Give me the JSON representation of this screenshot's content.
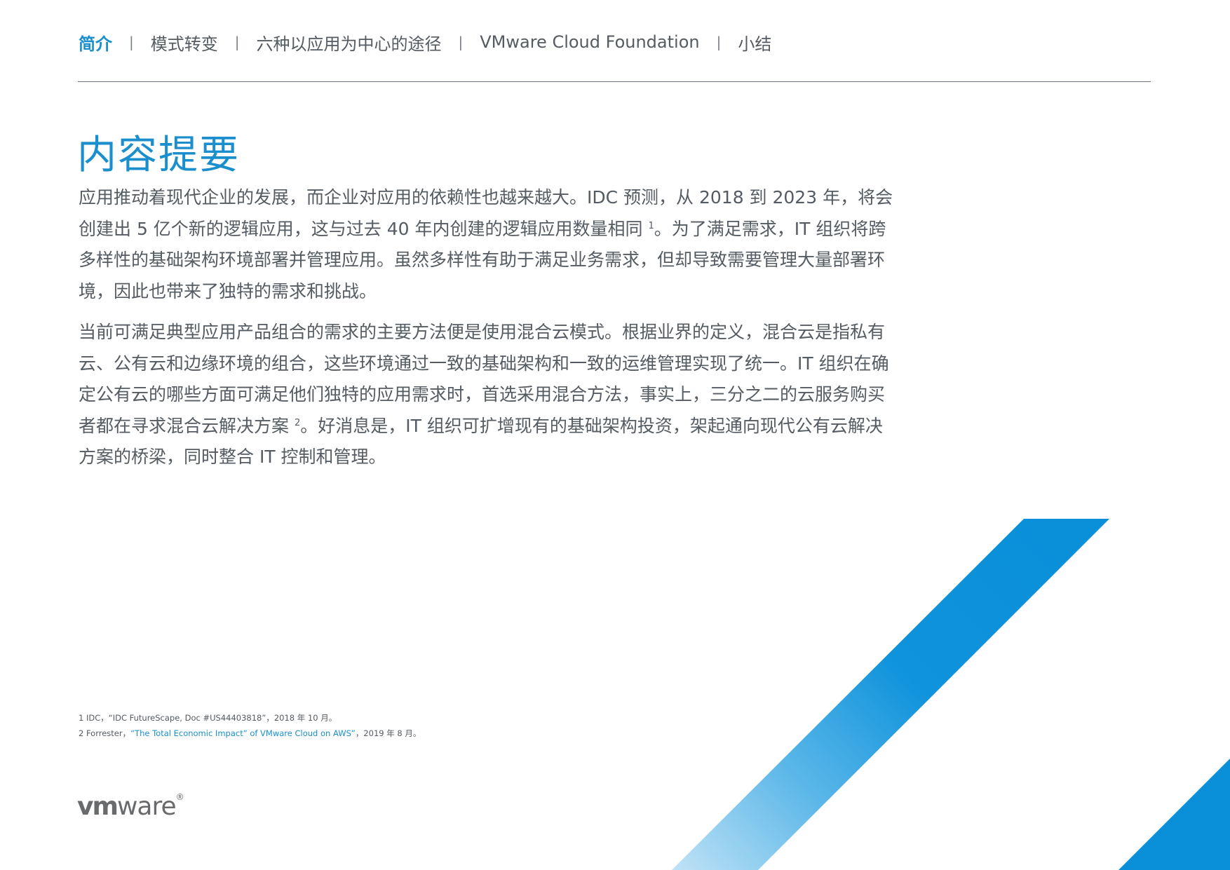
{
  "nav": {
    "items": [
      {
        "label": "简介",
        "active": true
      },
      {
        "label": "模式转变",
        "active": false
      },
      {
        "label": "六种以应用为中心的途径",
        "active": false
      },
      {
        "label": "VMware Cloud Foundation",
        "active": false
      },
      {
        "label": "小结",
        "active": false
      }
    ],
    "separator": "|"
  },
  "title": "内容提要",
  "p1": {
    "text_a": "应用推动着现代企业的发展，而企业对应用的依赖性也越来越大。IDC 预测，从 2018 到 2023 年，将会创建出 5 亿个新的逻辑应用，这与过去 40 年内创建的逻辑应用数量相同 ",
    "ref": "1",
    "text_b": "。为了满足需求，IT 组织将跨多样性的基础架构环境部署并管理应用。虽然多样性有助于满足业务需求，但却导致需要管理大量部署环境，因此也带来了独特的需求和挑战。"
  },
  "p2": {
    "text_a": "当前可满足典型应用产品组合的需求的主要方法便是使用混合云模式。根据业界的定义，混合云是指私有云、公有云和边缘环境的组合，这些环境通过一致的基础架构和一致的运维管理实现了统一。IT 组织在确定公有云的哪些方面可满足他们独特的应用需求时，首选采用混合方法，事实上，三分之二的云服务购买者都在寻求混合云解决方案 ",
    "ref": "2",
    "text_b": "。好消息是，IT 组织可扩增现有的基础架构投资，架起通向现代公有云解决方案的桥梁，同时整合 IT 控制和管理。"
  },
  "footnotes": {
    "fn1": "1  IDC，“IDC FutureScape, Doc #US44403818”，2018 年 10 月。",
    "fn2_prefix": "2  Forrester，",
    "fn2_link": "“The Total Economic Impact” of VMware Cloud on AWS”",
    "fn2_suffix": "，2019 年 8 月。"
  },
  "logo": {
    "vm": "vm",
    "ware": "ware",
    "reg": "®"
  },
  "colors": {
    "accent": "#1b8fce",
    "text": "#555b62",
    "stripe_light": "#a6d6f2",
    "stripe_dark": "#0a8fd9"
  }
}
